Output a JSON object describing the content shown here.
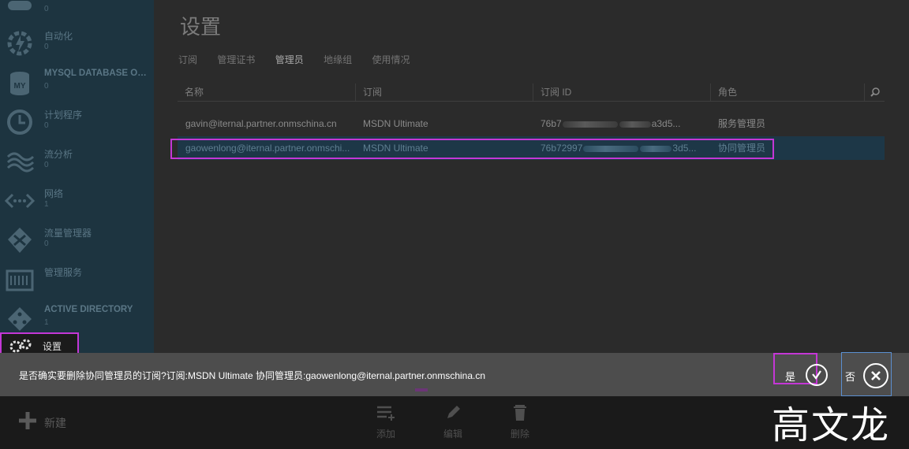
{
  "sidebar": {
    "items": [
      {
        "label": "",
        "count": "0",
        "icon": "storage-icon"
      },
      {
        "label": "自动化",
        "count": "0",
        "icon": "automation-icon"
      },
      {
        "label": "MYSQL DATABASE ON ...",
        "count": "0",
        "icon": "mysql-icon"
      },
      {
        "label": "计划程序",
        "count": "0",
        "icon": "scheduler-icon"
      },
      {
        "label": "流分析",
        "count": "0",
        "icon": "stream-analytics-icon"
      },
      {
        "label": "网络",
        "count": "1",
        "icon": "network-icon"
      },
      {
        "label": "流量管理器",
        "count": "0",
        "icon": "traffic-manager-icon"
      },
      {
        "label": "管理服务",
        "count": "",
        "icon": "management-services-icon"
      },
      {
        "label": "ACTIVE DIRECTORY",
        "count": "1",
        "icon": "active-directory-icon"
      }
    ],
    "settings_label": "设置"
  },
  "main": {
    "title": "设置",
    "tabs": [
      "订阅",
      "管理证书",
      "管理员",
      "地缘组",
      "使用情况"
    ],
    "active_tab": "管理员",
    "columns": [
      "名称",
      "订阅",
      "订阅 ID",
      "角色"
    ],
    "rows": [
      {
        "name": "gavin@iternal.partner.onmschina.cn",
        "subscription": "MSDN Ultimate",
        "id_prefix": "76b7",
        "id_suffix": "a3d5...",
        "role": "服务管理员"
      },
      {
        "name": "gaowenlong@iternal.partner.onmschi...",
        "subscription": "MSDN Ultimate",
        "id_prefix": "76b72997",
        "id_suffix": "3d5...",
        "role": "协同管理员"
      }
    ]
  },
  "confirm": {
    "text": "是否确实要删除协同管理员的订阅?订阅:MSDN Ultimate 协同管理员:gaowenlong@iternal.partner.onmschina.cn",
    "yes_label": "是",
    "no_label": "否"
  },
  "commands": {
    "new_label": "新建",
    "add_label": "添加",
    "edit_label": "编辑",
    "delete_label": "删除"
  },
  "watermark": "高文龙",
  "colors": {
    "highlight": "#c437d6",
    "sidebar_bg": "#1d3440",
    "selected_row": "#1d3747"
  }
}
